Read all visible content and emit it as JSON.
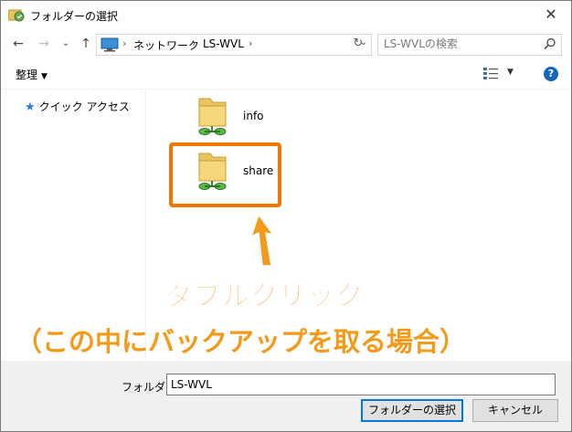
{
  "window": {
    "title": "フォルダーの選択",
    "close_glyph": "✕"
  },
  "address_bar": {
    "breadcrumb": [
      "ネットワーク",
      "LS-WVL"
    ],
    "separator": "›",
    "dropdown_glyph": "⌄",
    "refresh_glyph": "↻"
  },
  "nav": {
    "back_glyph": "←",
    "forward_glyph": "→",
    "recent_glyph": "⌄",
    "up_glyph": "↑"
  },
  "search": {
    "placeholder": "LS-WVLの検索"
  },
  "toolbar": {
    "organize_label": "整理",
    "organize_caret": "▼",
    "view_caret": "▼",
    "help_label": "?"
  },
  "nav_pane": {
    "quick_access_label": "クイック アクセス"
  },
  "items": [
    {
      "label": "info",
      "icon": "network-share-folder-icon"
    },
    {
      "label": "share",
      "icon": "network-share-folder-icon"
    }
  ],
  "annotation": {
    "line1": "ダブルクリック",
    "line2": "（この中にバックアップを取る場合）",
    "color": "#f39a1a",
    "highlight_color": "#f07800"
  },
  "footer": {
    "folder_label": "フォルダー:",
    "folder_value": "LS-WVL",
    "select_button": "フォルダーの選択",
    "cancel_button": "キャンセル"
  }
}
